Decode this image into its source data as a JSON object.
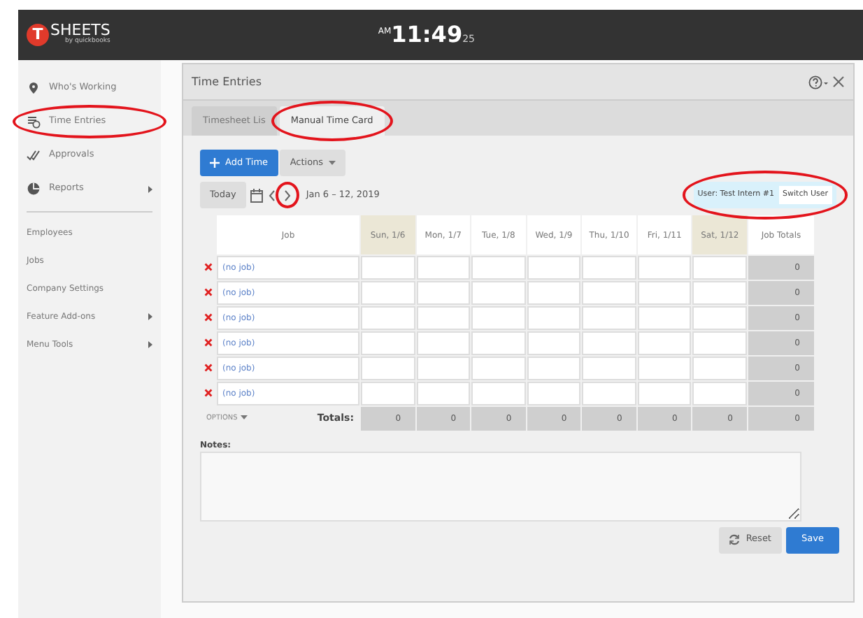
{
  "header": {
    "logo_letter": "T",
    "logo_text": "SHEETS",
    "logo_sub": "by quickbooks",
    "clock": {
      "meridiem": "AM",
      "time": "11:49",
      "seconds": "25"
    }
  },
  "sidebar": {
    "main_items": [
      {
        "label": "Who's Working",
        "circled": false,
        "submenu": false
      },
      {
        "label": "Time Entries",
        "circled": true,
        "submenu": false
      },
      {
        "label": "Approvals",
        "circled": false,
        "submenu": false
      },
      {
        "label": "Reports",
        "circled": false,
        "submenu": true
      }
    ],
    "sub_items": [
      {
        "label": "Employees",
        "submenu": false
      },
      {
        "label": "Jobs",
        "submenu": false
      },
      {
        "label": "Company Settings",
        "submenu": false
      },
      {
        "label": "Feature Add-ons",
        "submenu": true
      },
      {
        "label": "Menu Tools",
        "submenu": true
      }
    ]
  },
  "dialog": {
    "title": "Time Entries",
    "tabs": [
      {
        "label": "Timesheet Lis",
        "selected": false,
        "circled": false
      },
      {
        "label": "Manual Time Card",
        "selected": true,
        "circled": true
      }
    ],
    "add_button": "Add Time",
    "actions_button": "Actions",
    "today_button": "Today",
    "next_circled": true,
    "date_range": "Jan 6 – 12, 2019",
    "user_box": {
      "label": "User: Test Intern #1",
      "button": "Switch User",
      "circled": true
    },
    "table": {
      "job_header": "Job",
      "totals_header": "Job Totals",
      "days": [
        {
          "label": "Sun, 1/6",
          "weekend": true
        },
        {
          "label": "Mon, 1/7",
          "weekend": false
        },
        {
          "label": "Tue, 1/8",
          "weekend": false
        },
        {
          "label": "Wed, 1/9",
          "weekend": false
        },
        {
          "label": "Thu, 1/10",
          "weekend": false
        },
        {
          "label": "Fri, 1/11",
          "weekend": false
        },
        {
          "label": "Sat, 1/12",
          "weekend": true
        }
      ],
      "rows": [
        {
          "job": "(no job)",
          "total": "0"
        },
        {
          "job": "(no job)",
          "total": "0"
        },
        {
          "job": "(no job)",
          "total": "0"
        },
        {
          "job": "(no job)",
          "total": "0"
        },
        {
          "job": "(no job)",
          "total": "0"
        },
        {
          "job": "(no job)",
          "total": "0"
        }
      ],
      "options": "OPTIONS",
      "totals_label": "Totals:",
      "day_totals": [
        "0",
        "0",
        "0",
        "0",
        "0",
        "0",
        "0"
      ],
      "grand_total": "0"
    },
    "notes_label": "Notes:",
    "reset_button": "Reset",
    "save_button": "Save"
  }
}
